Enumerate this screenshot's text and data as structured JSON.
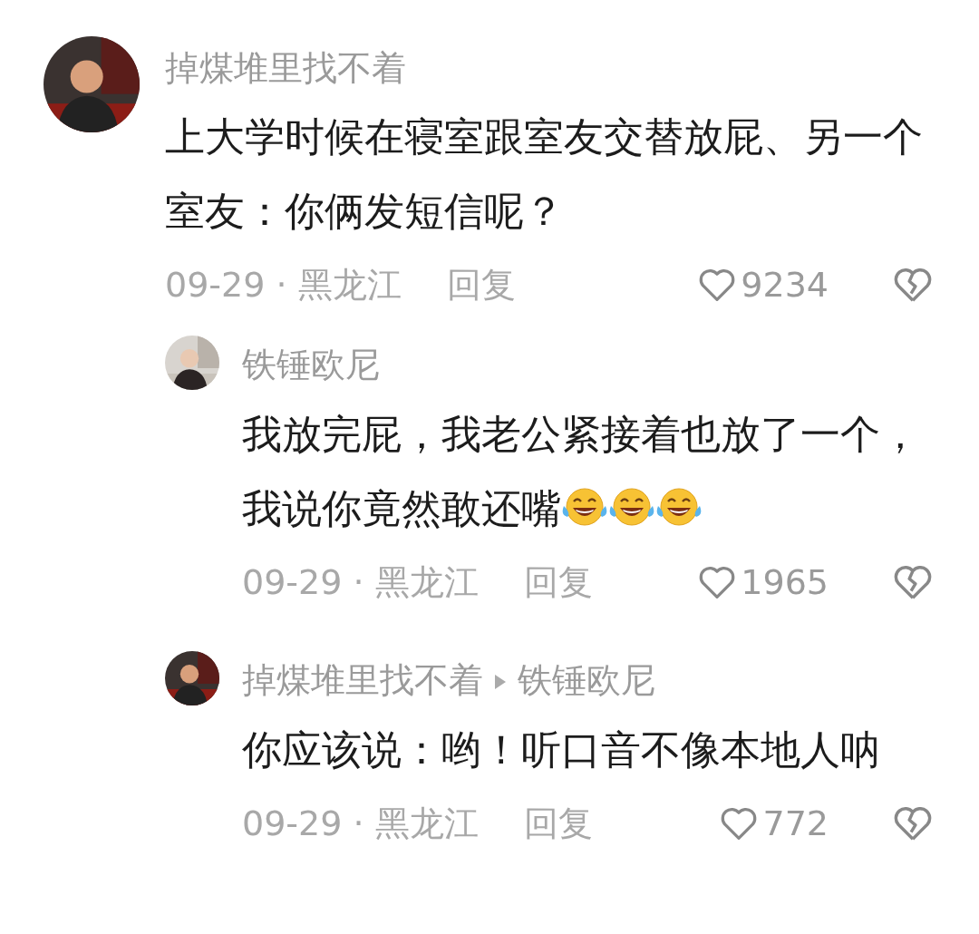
{
  "comments": [
    {
      "author": "掉煤堆里找不着",
      "text": "上大学时候在寝室跟室友交替放屁、另一个室友：你俩发短信呢？",
      "meta": "09-29 · 黑龙江",
      "reply_label": "回复",
      "likes": "9234",
      "replies": [
        {
          "author": "铁锤欧尼",
          "text": "我放完屁，我老公紧接着也放了一个，我说你竟然敢还嘴",
          "emojis": [
            {
              "kind": "laugh-cry"
            },
            {
              "kind": "laugh-cry"
            },
            {
              "kind": "laugh-cry"
            }
          ],
          "meta": "09-29 · 黑龙江",
          "reply_label": "回复",
          "likes": "1965"
        },
        {
          "author": "掉煤堆里找不着",
          "reply_to": "铁锤欧尼",
          "text": "你应该说：哟！听口音不像本地人呐",
          "meta": "09-29 · 黑龙江",
          "reply_label": "回复",
          "likes": "772"
        }
      ]
    }
  ]
}
